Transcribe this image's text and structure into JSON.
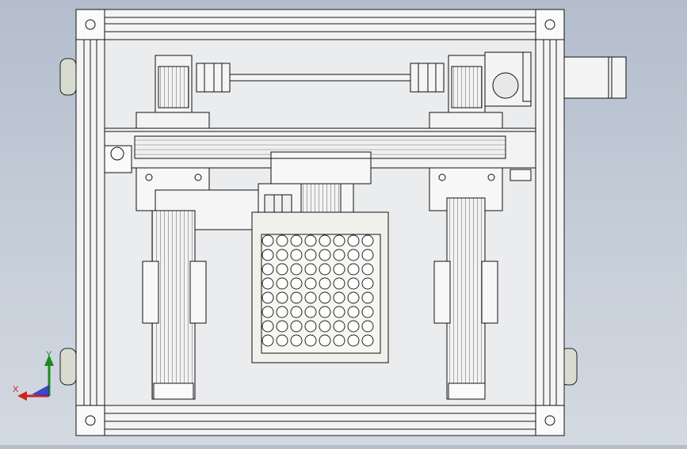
{
  "viewport": {
    "background_top": "#b3bdcc",
    "background_bottom": "#d3d9e1"
  },
  "model": {
    "frame_color": "#f2f2f2",
    "line_color": "#1a1a1a",
    "hole_grid": {
      "rows": 8,
      "cols": 8
    },
    "component_names": [
      "aluminum-profile-frame",
      "top-linear-module",
      "left-vertical-module",
      "right-vertical-module",
      "gripper-carriage",
      "well-plate",
      "drive-shaft",
      "servo-motor"
    ]
  },
  "triad": {
    "x_label": "X",
    "y_label": "Y",
    "x_color": "#d02020",
    "y_color": "#1d8a1d",
    "z_color": "#2030c0"
  }
}
